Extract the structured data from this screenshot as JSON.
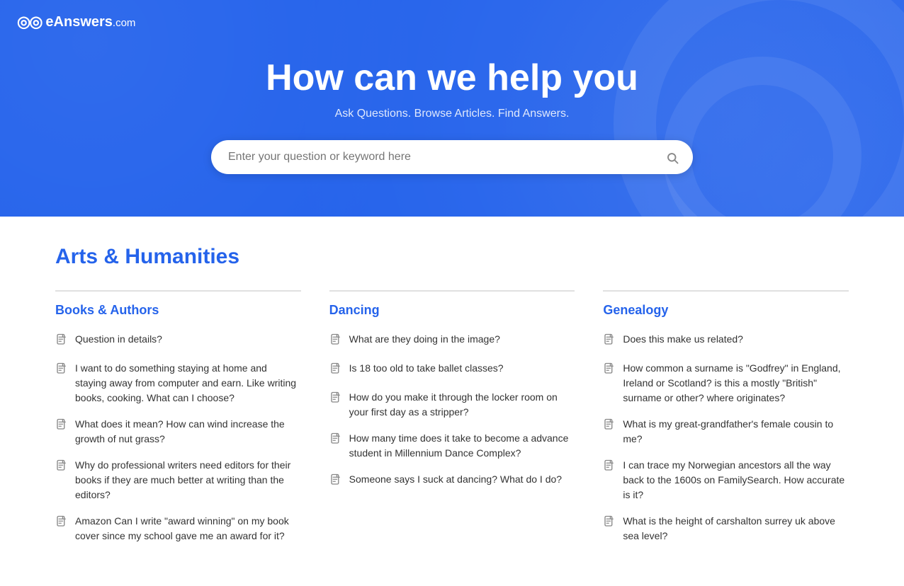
{
  "logo": {
    "icon": "◎◎",
    "brand": "eAnswers",
    "tld": ".com"
  },
  "hero": {
    "title": "How can we help you",
    "subtitle": "Ask Questions. Browse Articles. Find Answers.",
    "search_placeholder": "Enter your question or keyword here"
  },
  "section": {
    "title": "Arts & Humanities",
    "categories": [
      {
        "id": "books-authors",
        "title": "Books & Authors",
        "questions": [
          "Question in details?",
          "I want to do something staying at home and staying away from computer and earn. Like writing books, cooking. What can I choose?",
          "What does it mean? How can wind increase the growth of nut grass?",
          "Why do professional writers need editors for their books if they are much better at writing than the editors?",
          "Amazon Can I write \"award winning\" on my book cover since my school gave me an award for it?"
        ]
      },
      {
        "id": "dancing",
        "title": "Dancing",
        "questions": [
          "What are they doing in the image?",
          "Is 18 too old to take ballet classes?",
          "How do you make it through the locker room on your first day as a stripper?",
          "How many time does it take to become a advance student in Millennium Dance Complex?",
          "Someone says I suck at dancing? What do I do?"
        ]
      },
      {
        "id": "genealogy",
        "title": "Genealogy",
        "questions": [
          "Does this make us related?",
          "How common a surname is \"Godfrey\" in England, Ireland or Scotland? is this a mostly \"British\" surname or other? where originates?",
          "What is my great-grandfather's female cousin to me?",
          "I can trace my Norwegian ancestors all the way back to the 1600s on FamilySearch. How accurate is it?",
          "What is the height of carshalton surrey uk above sea level?"
        ]
      }
    ]
  }
}
